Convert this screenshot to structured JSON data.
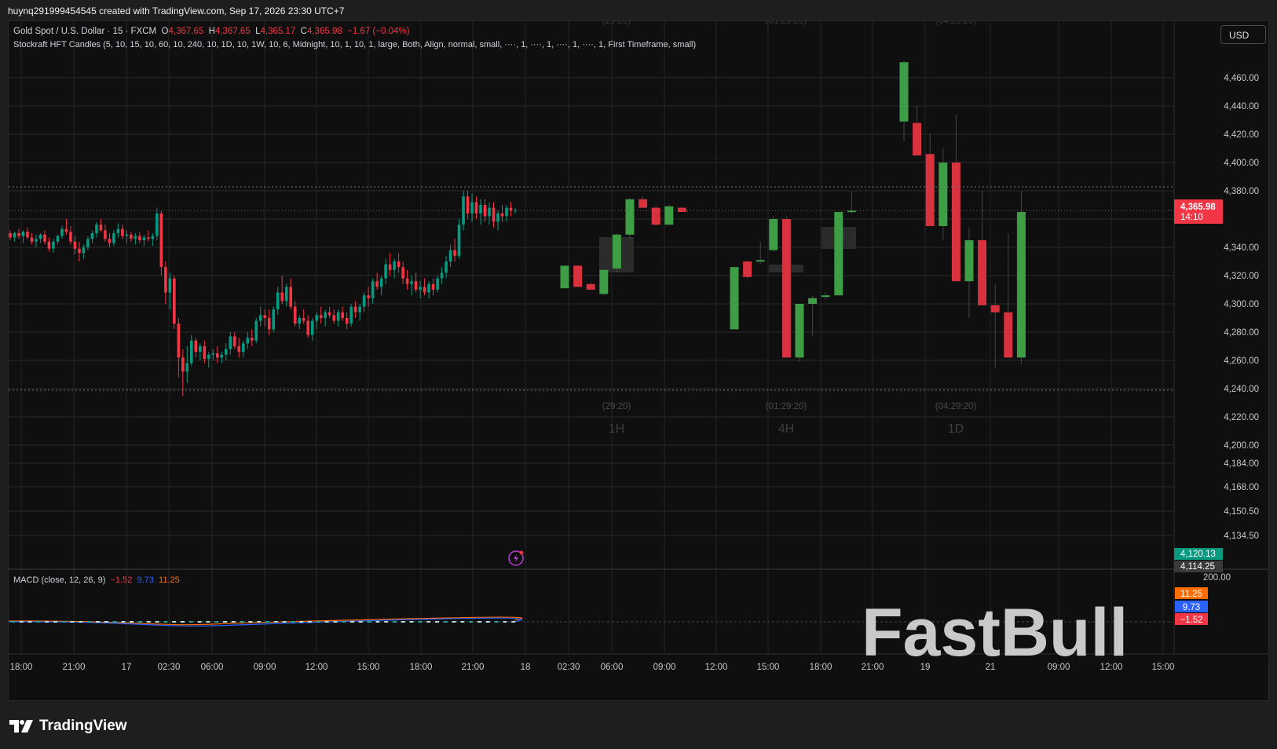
{
  "header": {
    "title": "huynq291999454545 created with TradingView.com, Sep 17, 2026 23:30 UTC+7"
  },
  "legend": {
    "symbol": "Gold Spot / U.S. Dollar · 15 · FXCM",
    "o_label": "O",
    "o_value": "4,367.65",
    "h_label": "H",
    "h_value": "4,367.65",
    "l_label": "L",
    "l_value": "4,365.17",
    "c_label": "C",
    "c_value": "4,365.98",
    "change": "−1.67 (−0.04%)",
    "indicator": "Stockraft HFT Candles (5, 10, 15, 10, 60, 10, 240, 10, 1D, 10, 1W, 10, 6, Midnight, 10, 1, 10, 1, large, Both, Align, normal, small, ····, 1, ····, 1, ····, 1, ····, 1, First Timeframe, small)"
  },
  "macd_legend": {
    "label": "MACD (close, 12, 26, 9)",
    "macd": "−1.52",
    "signal": "9.73",
    "hist": "11.25"
  },
  "currency_button": "USD",
  "watermark": "FastBull",
  "brand": "TradingView",
  "price_badge": {
    "price": "4,365.98",
    "countdown": "14:10"
  },
  "chart_data": {
    "type": "candlestick",
    "symbol": "XAUUSD",
    "timeframe": "15",
    "last_price": 4365.98,
    "y_ticks_upper": [
      4460,
      4440,
      4420,
      4400,
      4380,
      4360,
      4340,
      4320,
      4300,
      4280,
      4260,
      4240,
      4220,
      4200
    ],
    "y_ticks_lower": [
      4184,
      4168,
      4150.5,
      4134.5
    ],
    "y_tick_labels_upper": [
      "4,460.00",
      "4,440.00",
      "4,420.00",
      "4,400.00",
      "4,380.00",
      null,
      "4,340.00",
      "4,320.00",
      "4,300.00",
      "4,280.00",
      "4,260.00",
      "4,240.00",
      "4,220.00",
      "4,200.00"
    ],
    "y_tick_labels_lower": [
      "4,184.00",
      "4,168.00",
      "4,150.50",
      "4,134.50"
    ],
    "x_tick_labels": [
      "18:00",
      "21:00",
      "17",
      "02:30",
      "06:00",
      "09:00",
      "12:00",
      "15:00",
      "18:00",
      "21:00",
      "18",
      "02:30",
      "06:00",
      "09:00",
      "12:00",
      "15:00",
      "18:00",
      "21:00",
      "19",
      "21",
      "09:00",
      "12:00",
      "15:00"
    ],
    "price_labels": [
      {
        "text": "4,120.13",
        "color": "#089981"
      },
      {
        "text": "4,114.25",
        "color": "#3a3a3a"
      }
    ],
    "macd_axis": {
      "label": "200.00"
    },
    "macd_badges": [
      {
        "text": "11.25",
        "color": "#ff6d00"
      },
      {
        "text": "9.73",
        "color": "#2962ff"
      },
      {
        "text": "−1.52",
        "color": "#f23645"
      }
    ],
    "hft_groups": [
      {
        "tf": "1H",
        "remaining": "(29:20)"
      },
      {
        "tf": "4H",
        "remaining": "(01:29:20)"
      },
      {
        "tf": "1D",
        "remaining": "(04:29:20)"
      }
    ],
    "colors": {
      "up": "#089981",
      "down": "#f23645",
      "hft_up": "#3d9e45",
      "hft_down": "#d8323f"
    },
    "ohlc_15m": [
      [
        4350,
        4352,
        4345,
        4347
      ],
      [
        4347,
        4351,
        4344,
        4350
      ],
      [
        4350,
        4353,
        4346,
        4348
      ],
      [
        4348,
        4352,
        4343,
        4351
      ],
      [
        4351,
        4354,
        4346,
        4347
      ],
      [
        4347,
        4350,
        4342,
        4344
      ],
      [
        4344,
        4349,
        4340,
        4346
      ],
      [
        4346,
        4350,
        4343,
        4349
      ],
      [
        4349,
        4352,
        4342,
        4344
      ],
      [
        4344,
        4347,
        4337,
        4339
      ],
      [
        4339,
        4346,
        4336,
        4344
      ],
      [
        4344,
        4349,
        4342,
        4348
      ],
      [
        4348,
        4355,
        4346,
        4353
      ],
      [
        4353,
        4360,
        4349,
        4351
      ],
      [
        4351,
        4355,
        4342,
        4344
      ],
      [
        4344,
        4348,
        4335,
        4339
      ],
      [
        4339,
        4344,
        4330,
        4336
      ],
      [
        4336,
        4342,
        4332,
        4340
      ],
      [
        4340,
        4348,
        4338,
        4346
      ],
      [
        4346,
        4352,
        4343,
        4350
      ],
      [
        4350,
        4358,
        4347,
        4356
      ],
      [
        4356,
        4360,
        4351,
        4352
      ],
      [
        4352,
        4356,
        4344,
        4346
      ],
      [
        4346,
        4350,
        4340,
        4343
      ],
      [
        4343,
        4352,
        4341,
        4350
      ],
      [
        4350,
        4357,
        4347,
        4353
      ],
      [
        4353,
        4356,
        4346,
        4348
      ],
      [
        4348,
        4352,
        4343,
        4349
      ],
      [
        4349,
        4351,
        4344,
        4346
      ],
      [
        4346,
        4350,
        4342,
        4348
      ],
      [
        4348,
        4351,
        4343,
        4345
      ],
      [
        4345,
        4349,
        4341,
        4347
      ],
      [
        4347,
        4352,
        4344,
        4346
      ],
      [
        4346,
        4350,
        4341,
        4348
      ],
      [
        4348,
        4368,
        4345,
        4364
      ],
      [
        4364,
        4366,
        4320,
        4326
      ],
      [
        4326,
        4330,
        4300,
        4308
      ],
      [
        4308,
        4322,
        4296,
        4318
      ],
      [
        4318,
        4320,
        4282,
        4286
      ],
      [
        4286,
        4290,
        4248,
        4262
      ],
      [
        4262,
        4268,
        4235,
        4252
      ],
      [
        4252,
        4270,
        4244,
        4258
      ],
      [
        4258,
        4278,
        4256,
        4274
      ],
      [
        4274,
        4276,
        4262,
        4266
      ],
      [
        4266,
        4272,
        4260,
        4270
      ],
      [
        4270,
        4274,
        4258,
        4261
      ],
      [
        4261,
        4266,
        4255,
        4264
      ],
      [
        4264,
        4268,
        4260,
        4265
      ],
      [
        4265,
        4270,
        4258,
        4262
      ],
      [
        4262,
        4266,
        4258,
        4264
      ],
      [
        4264,
        4272,
        4260,
        4268
      ],
      [
        4268,
        4280,
        4264,
        4277
      ],
      [
        4277,
        4280,
        4268,
        4270
      ],
      [
        4270,
        4276,
        4262,
        4266
      ],
      [
        4266,
        4274,
        4262,
        4272
      ],
      [
        4272,
        4280,
        4268,
        4276
      ],
      [
        4276,
        4282,
        4270,
        4274
      ],
      [
        4274,
        4290,
        4272,
        4288
      ],
      [
        4288,
        4298,
        4284,
        4292
      ],
      [
        4292,
        4296,
        4284,
        4290
      ],
      [
        4290,
        4296,
        4278,
        4282
      ],
      [
        4282,
        4298,
        4280,
        4296
      ],
      [
        4296,
        4312,
        4292,
        4308
      ],
      [
        4308,
        4320,
        4300,
        4302
      ],
      [
        4302,
        4314,
        4298,
        4312
      ],
      [
        4312,
        4318,
        4296,
        4298
      ],
      [
        4298,
        4302,
        4284,
        4286
      ],
      [
        4286,
        4292,
        4282,
        4290
      ],
      [
        4290,
        4296,
        4286,
        4288
      ],
      [
        4288,
        4292,
        4276,
        4278
      ],
      [
        4278,
        4290,
        4274,
        4288
      ],
      [
        4288,
        4294,
        4282,
        4292
      ],
      [
        4292,
        4298,
        4286,
        4290
      ],
      [
        4290,
        4296,
        4284,
        4294
      ],
      [
        4294,
        4298,
        4290,
        4292
      ],
      [
        4292,
        4296,
        4286,
        4288
      ],
      [
        4288,
        4296,
        4284,
        4294
      ],
      [
        4294,
        4298,
        4288,
        4290
      ],
      [
        4290,
        4294,
        4282,
        4286
      ],
      [
        4286,
        4300,
        4284,
        4298
      ],
      [
        4298,
        4302,
        4290,
        4294
      ],
      [
        4294,
        4300,
        4288,
        4298
      ],
      [
        4298,
        4308,
        4294,
        4306
      ],
      [
        4306,
        4312,
        4298,
        4304
      ],
      [
        4304,
        4318,
        4300,
        4316
      ],
      [
        4316,
        4322,
        4310,
        4312
      ],
      [
        4312,
        4320,
        4306,
        4318
      ],
      [
        4318,
        4332,
        4314,
        4328
      ],
      [
        4328,
        4336,
        4320,
        4324
      ],
      [
        4324,
        4332,
        4318,
        4330
      ],
      [
        4330,
        4336,
        4322,
        4326
      ],
      [
        4326,
        4330,
        4314,
        4318
      ],
      [
        4318,
        4324,
        4310,
        4314
      ],
      [
        4314,
        4320,
        4306,
        4316
      ],
      [
        4316,
        4322,
        4308,
        4310
      ],
      [
        4310,
        4316,
        4304,
        4312
      ],
      [
        4312,
        4318,
        4306,
        4308
      ],
      [
        4308,
        4316,
        4304,
        4314
      ],
      [
        4314,
        4318,
        4306,
        4310
      ],
      [
        4310,
        4320,
        4308,
        4318
      ],
      [
        4318,
        4326,
        4314,
        4322
      ],
      [
        4322,
        4334,
        4318,
        4330
      ],
      [
        4330,
        4342,
        4326,
        4338
      ],
      [
        4338,
        4346,
        4330,
        4334
      ],
      [
        4334,
        4360,
        4332,
        4356
      ],
      [
        4356,
        4380,
        4352,
        4376
      ],
      [
        4376,
        4380,
        4360,
        4364
      ],
      [
        4364,
        4378,
        4358,
        4372
      ],
      [
        4372,
        4376,
        4360,
        4364
      ],
      [
        4364,
        4374,
        4356,
        4370
      ],
      [
        4370,
        4374,
        4358,
        4362
      ],
      [
        4362,
        4372,
        4356,
        4368
      ],
      [
        4368,
        4372,
        4354,
        4358
      ],
      [
        4358,
        4366,
        4352,
        4364
      ],
      [
        4364,
        4370,
        4358,
        4362
      ],
      [
        4362,
        4370,
        4358,
        4368
      ],
      [
        4368,
        4372,
        4362,
        4366
      ],
      [
        4366,
        4368,
        4364,
        4366
      ]
    ],
    "hft_candles": [
      {
        "group": "1H",
        "ohlc": [
          [
            4311,
            4327,
            4311,
            4327
          ],
          [
            4327,
            4327,
            4312,
            4312
          ],
          [
            4314,
            4315,
            4310,
            4310
          ],
          [
            4307,
            4325,
            4306,
            4324
          ],
          [
            4325,
            4350,
            4322,
            4349
          ],
          [
            4349,
            4375,
            4346,
            4374
          ],
          [
            4374,
            4376,
            4368,
            4368
          ],
          [
            4368,
            4370,
            4355,
            4356
          ],
          [
            4356,
            4370,
            4356,
            4369
          ],
          [
            4368,
            4369,
            4365,
            4365
          ]
        ]
      },
      {
        "group": "4H",
        "ohlc": [
          [
            4282,
            4326,
            4282,
            4326
          ],
          [
            4330,
            4331,
            4318,
            4319
          ],
          [
            4330,
            4344,
            4328,
            4331
          ],
          [
            4338,
            4362,
            4337,
            4360
          ],
          [
            4360,
            4362,
            4262,
            4262
          ],
          [
            4262,
            4300,
            4259,
            4300
          ],
          [
            4300,
            4306,
            4277,
            4304
          ],
          [
            4305,
            4308,
            4303,
            4306
          ],
          [
            4306,
            4365,
            4306,
            4365
          ],
          [
            4365,
            4380,
            4364,
            4366
          ]
        ]
      },
      {
        "group": "1D",
        "ohlc": [
          [
            4429,
            4472,
            4415,
            4471
          ],
          [
            4428,
            4440,
            4406,
            4405
          ],
          [
            4406,
            4420,
            4355,
            4355
          ],
          [
            4355,
            4410,
            4345,
            4400
          ],
          [
            4400,
            4434,
            4316,
            4316
          ],
          [
            4316,
            4354,
            4290,
            4345
          ],
          [
            4345,
            4380,
            4299,
            4299
          ],
          [
            4299,
            4314,
            4254,
            4294
          ],
          [
            4294,
            4350,
            4262,
            4262
          ],
          [
            4262,
            4380,
            4257,
            4365
          ]
        ]
      }
    ],
    "grid": true
  }
}
